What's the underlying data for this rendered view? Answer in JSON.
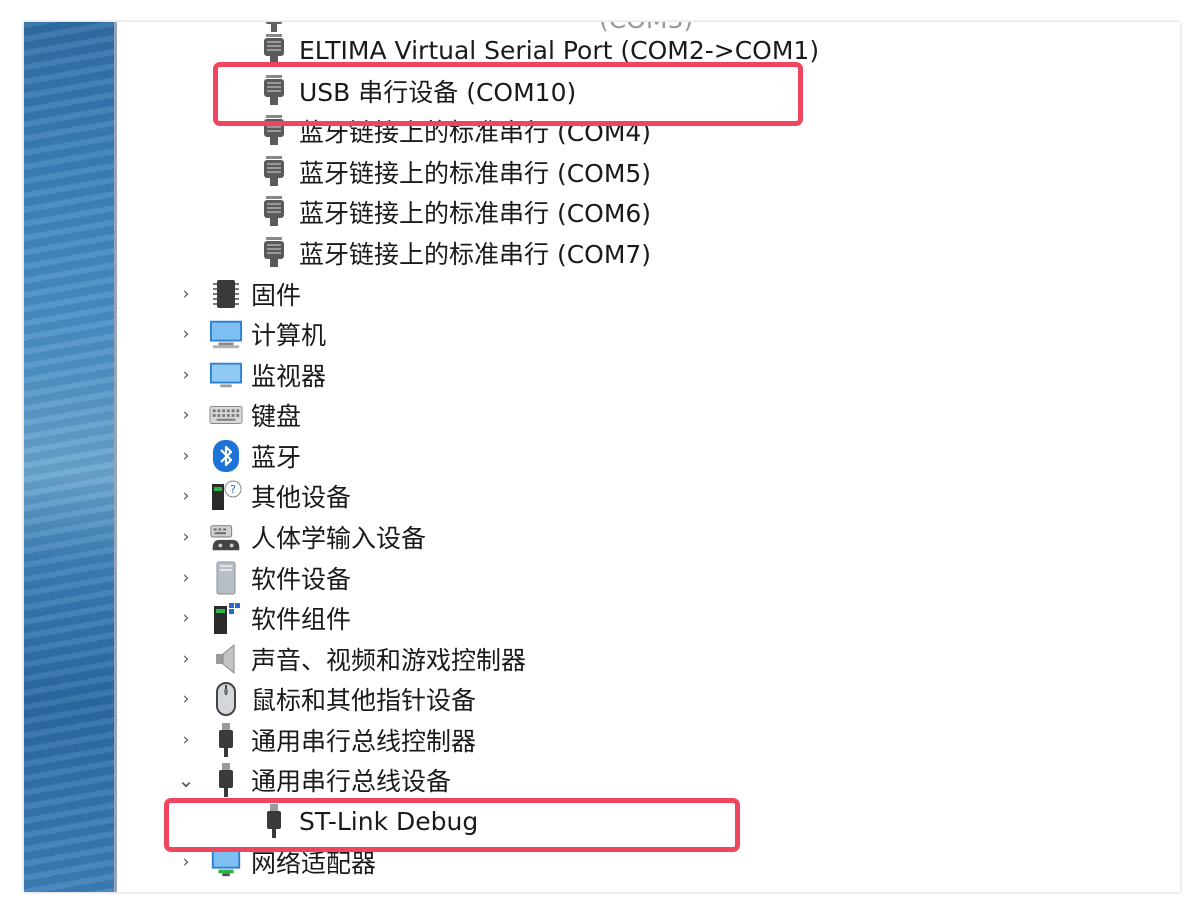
{
  "tree": {
    "partial_top_label": "(COM3)",
    "port_children": [
      {
        "label": "ELTIMA Virtual Serial Port (COM2->COM1)",
        "icon": "serial-port-icon"
      },
      {
        "label": "USB 串行设备 (COM10)",
        "icon": "serial-port-icon"
      },
      {
        "label": "蓝牙链接上的标准串行 (COM4)",
        "icon": "serial-port-icon"
      },
      {
        "label": "蓝牙链接上的标准串行 (COM5)",
        "icon": "serial-port-icon"
      },
      {
        "label": "蓝牙链接上的标准串行 (COM6)",
        "icon": "serial-port-icon"
      },
      {
        "label": "蓝牙链接上的标准串行 (COM7)",
        "icon": "serial-port-icon"
      }
    ],
    "categories": [
      {
        "label": "固件",
        "icon": "firmware-chip-icon",
        "expanded": false
      },
      {
        "label": "计算机",
        "icon": "computer-icon",
        "expanded": false
      },
      {
        "label": "监视器",
        "icon": "monitor-icon",
        "expanded": false
      },
      {
        "label": "键盘",
        "icon": "keyboard-icon",
        "expanded": false
      },
      {
        "label": "蓝牙",
        "icon": "bluetooth-icon",
        "expanded": false
      },
      {
        "label": "其他设备",
        "icon": "unknown-device-icon",
        "expanded": false
      },
      {
        "label": "人体学输入设备",
        "icon": "hid-icon",
        "expanded": false
      },
      {
        "label": "软件设备",
        "icon": "software-device-icon",
        "expanded": false
      },
      {
        "label": "软件组件",
        "icon": "software-component-icon",
        "expanded": false
      },
      {
        "label": "声音、视频和游戏控制器",
        "icon": "speaker-icon",
        "expanded": false
      },
      {
        "label": "鼠标和其他指针设备",
        "icon": "mouse-icon",
        "expanded": false
      },
      {
        "label": "通用串行总线控制器",
        "icon": "usb-plug-icon",
        "expanded": false
      },
      {
        "label": "通用串行总线设备",
        "icon": "usb-plug-icon",
        "expanded": true
      }
    ],
    "usb_device_children": [
      {
        "label": "ST-Link Debug",
        "icon": "usb-plug-icon"
      }
    ],
    "bottom_categories": [
      {
        "label": "网络适配器",
        "icon": "network-adapter-icon",
        "expanded": false
      }
    ]
  },
  "chevrons": {
    "collapsed": "›",
    "expanded": "⌄"
  },
  "highlight_color": "#f0455e"
}
